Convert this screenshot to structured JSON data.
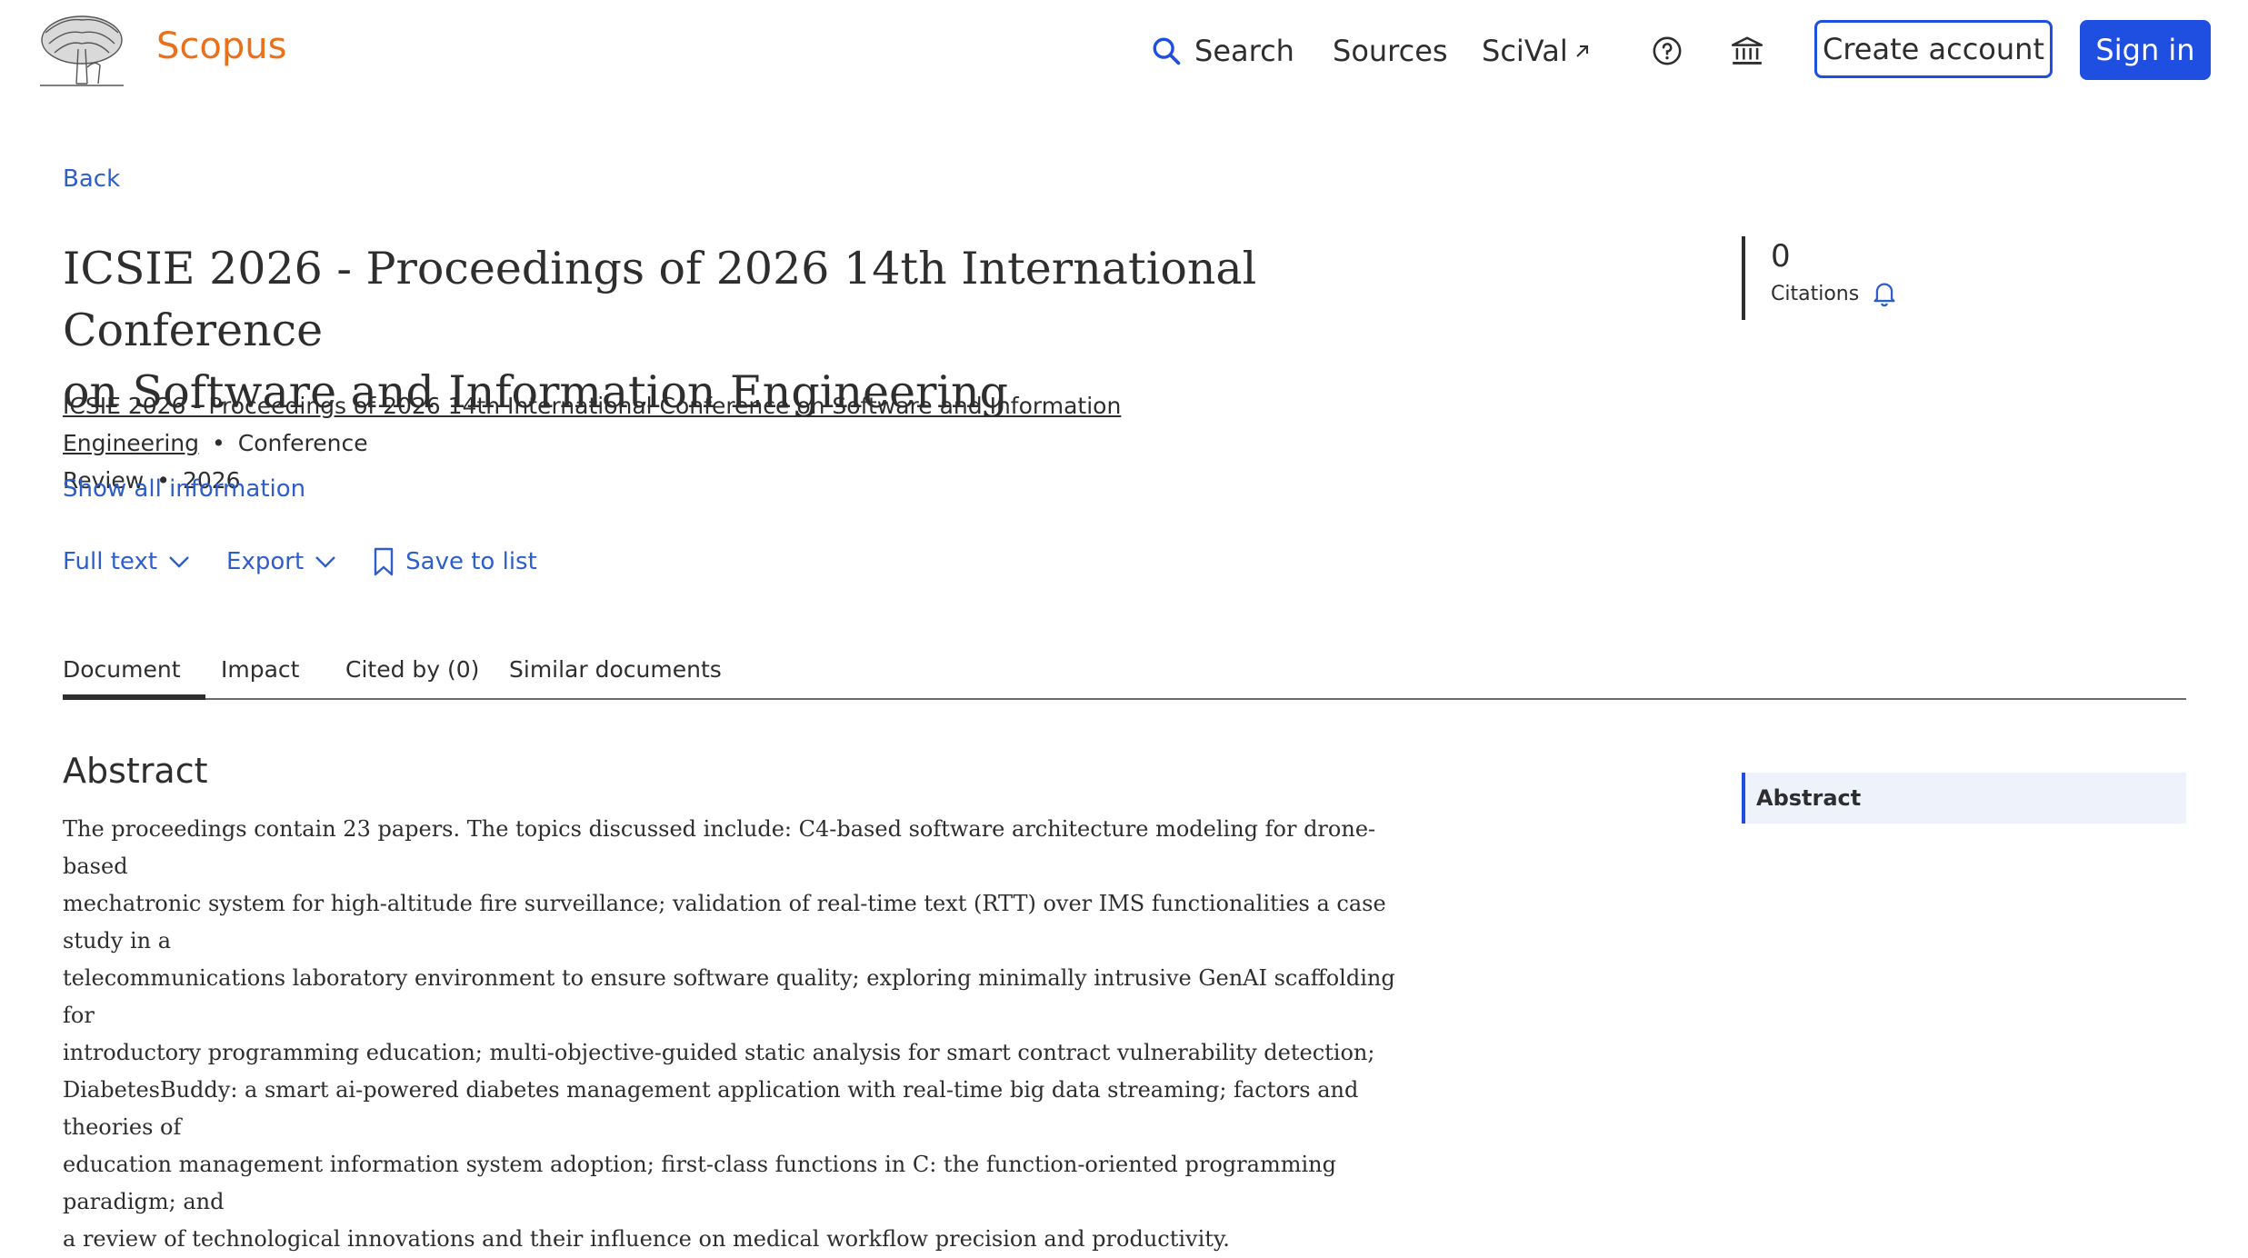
{
  "header": {
    "brand": "Scopus",
    "nav": {
      "search": "Search",
      "sources": "Sources",
      "scival": "SciVal"
    },
    "create_account": "Create account",
    "sign_in": "Sign in",
    "icons": [
      "elsevier-tree-logo",
      "search-icon",
      "external-link-icon",
      "help-icon",
      "institution-icon"
    ],
    "accent_color": "#1f4fe0",
    "brand_color": "#e9711c"
  },
  "back_label": "Back",
  "document": {
    "title_line1": "ICSIE 2026 - Proceedings of 2026 14th International Conference",
    "title_line2": "on Software and Information Engineering",
    "source_title": "ICSIE 2026 - Proceedings of 2026 14th International Conference on Software and Information Engineering",
    "doc_type_1": "Conference",
    "doc_type_2": "Review",
    "year": "2026",
    "show_all": "Show all information"
  },
  "actions": {
    "full_text": "Full text",
    "export": "Export",
    "save_to_list": "Save to list"
  },
  "tabs": [
    {
      "label": "Document"
    },
    {
      "label": "Impact"
    },
    {
      "label": "Cited by (0)"
    },
    {
      "label": "Similar documents"
    }
  ],
  "abstract": {
    "heading": "Abstract",
    "line1": "The proceedings contain 23 papers. The topics discussed include: C4-based software architecture modeling for drone-based",
    "line2": "mechatronic system for high-altitude fire surveillance; validation of real-time text (RTT) over IMS functionalities a case study in a",
    "line3": "telecommunications laboratory environment to ensure software quality; exploring minimally intrusive GenAI scaffolding for",
    "line4": "introductory programming education; multi-objective-guided static analysis for smart contract vulnerability detection;",
    "line5": "DiabetesBuddy: a smart ai-powered diabetes management application with real-time big data streaming; factors and theories of",
    "line6": "education management information system adoption; first-class functions in C: the function-oriented programming paradigm; and",
    "line7": "a review of technological innovations and their influence on medical workflow precision and productivity."
  },
  "citations": {
    "count": "0",
    "label": "Citations"
  },
  "toc": {
    "item": "Abstract"
  }
}
